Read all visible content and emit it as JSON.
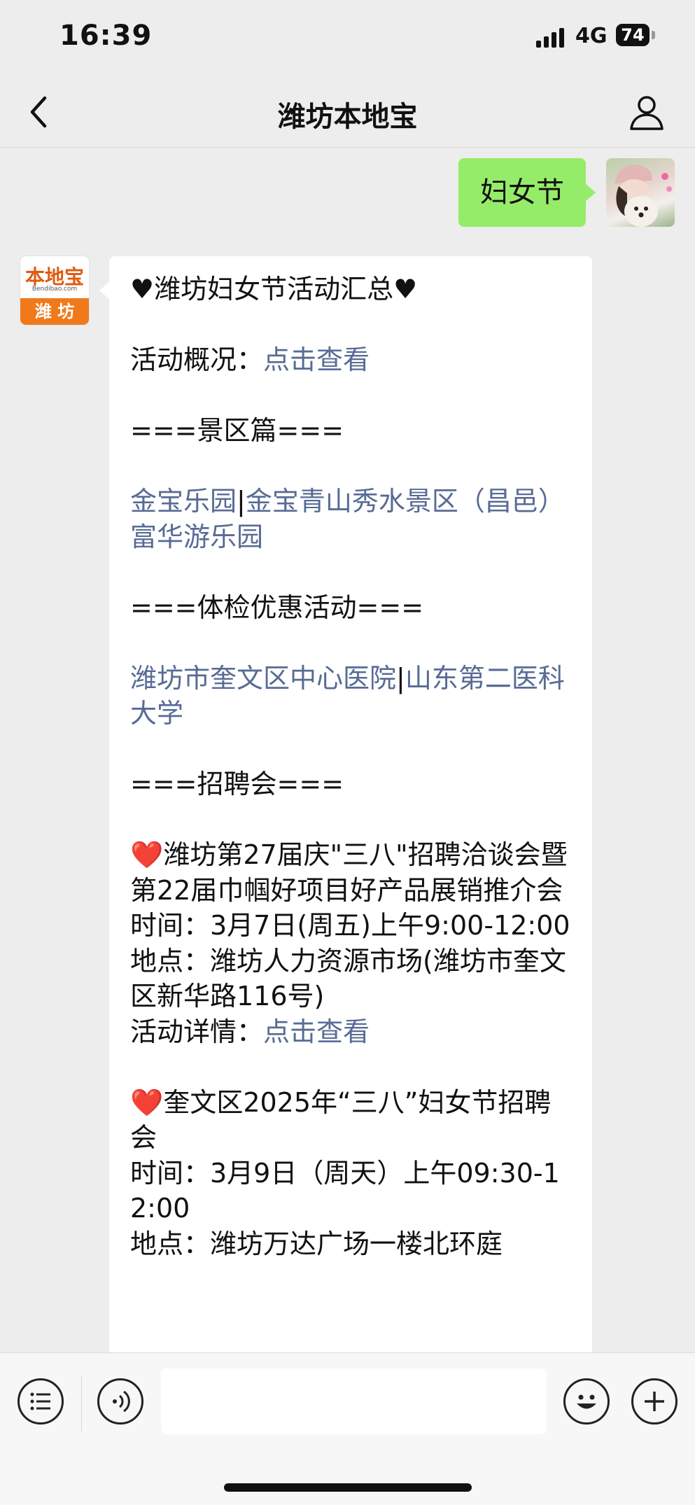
{
  "status_bar": {
    "time": "16:39",
    "network": "4G",
    "battery": "74"
  },
  "nav": {
    "title": "潍坊本地宝"
  },
  "messages": {
    "user_text": "妇女节",
    "bot_logo": {
      "top": "本地宝",
      "url": "Bendibao.com",
      "bottom": "潍 坊"
    }
  },
  "article": [
    {
      "t": "♥潍坊妇女节活动汇总♥"
    },
    {
      "t": ""
    },
    {
      "t": "活动概况：",
      "link": "点击查看"
    },
    {
      "t": ""
    },
    {
      "t": "===景区篇==="
    },
    {
      "t": ""
    },
    {
      "links": [
        "金宝乐园",
        "|",
        "金宝青山秀水景区（昌邑）"
      ]
    },
    {
      "links": [
        "富华游乐园"
      ]
    },
    {
      "t": ""
    },
    {
      "t": "===体检优惠活动==="
    },
    {
      "t": ""
    },
    {
      "links": [
        "潍坊市奎文区中心医院",
        "|",
        "山东第二医科大学"
      ]
    },
    {
      "t": ""
    },
    {
      "t": "===招聘会==="
    },
    {
      "t": ""
    },
    {
      "t": "❤️潍坊第27届庆\"三八\"招聘洽谈会暨第22届巾帼好项目好产品展销推介会"
    },
    {
      "t": "时间：3月7日(周五)上午9:00-12:00"
    },
    {
      "t": "地点：潍坊人力资源市场(潍坊市奎文区新华路116号)"
    },
    {
      "t": "活动详情：",
      "link": "点击查看"
    },
    {
      "t": ""
    },
    {
      "t": "❤️奎文区2025年“三八”妇女节招聘会"
    },
    {
      "t": "时间：3月9日（周天）上午09:30-12:00"
    },
    {
      "t": "地点：潍坊万达广场一楼北环庭"
    }
  ],
  "colors": {
    "link": "#576b95",
    "my_bubble": "#95ec69",
    "logo_orange": "#f07a1b"
  },
  "icons": [
    "back-chevron-icon",
    "profile-icon",
    "menu-list-icon",
    "voice-icon",
    "emoji-icon",
    "plus-icon"
  ]
}
